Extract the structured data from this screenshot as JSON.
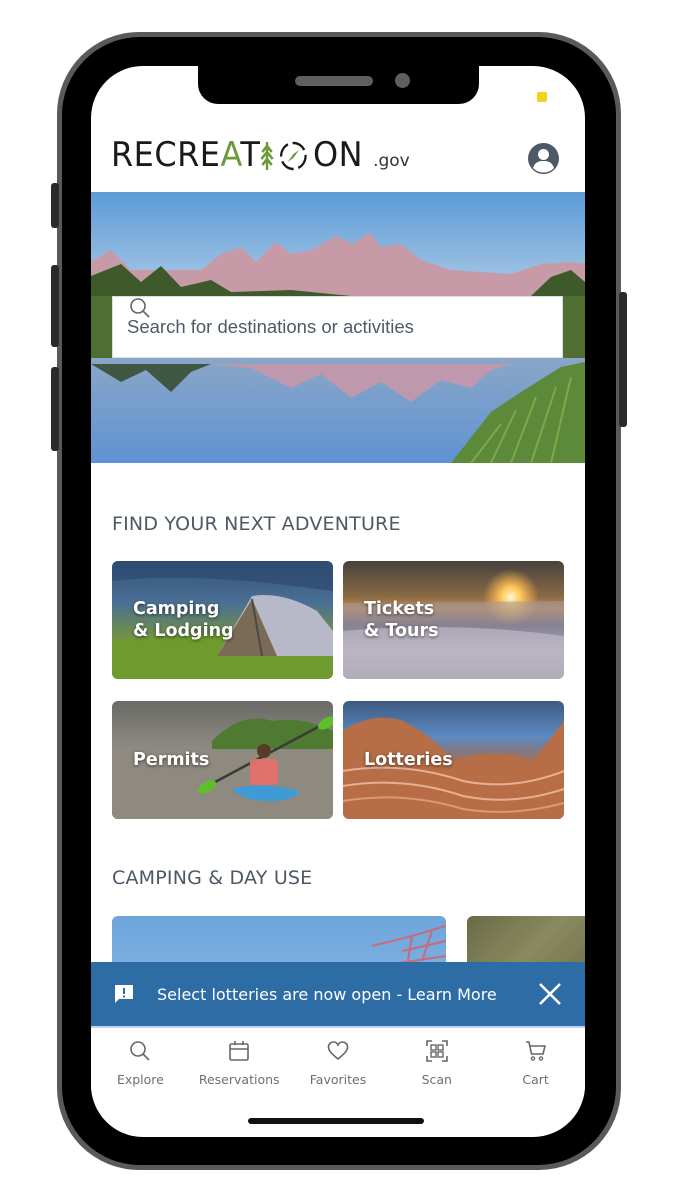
{
  "device": {
    "status_indicator_color": "#f2d31b"
  },
  "header": {
    "logo": {
      "prefix": "RECRE",
      "accent": "A",
      "middle": "T",
      "suffix": "ON",
      "domain": ".gov",
      "full": "RECREATION.gov"
    },
    "account_icon": "account-circle-icon"
  },
  "search": {
    "placeholder": "Search for destinations or activities",
    "value": "",
    "icon": "search-icon"
  },
  "adventure": {
    "title": "FIND YOUR NEXT ADVENTURE",
    "tiles": [
      {
        "label": "Camping\n& Lodging",
        "image": "tent-on-hillside"
      },
      {
        "label": "Tickets\n& Tours",
        "image": "sunset-over-snow"
      },
      {
        "label": "Permits",
        "image": "kayaker-on-river"
      },
      {
        "label": "Lotteries",
        "image": "sandstone-wave"
      }
    ]
  },
  "camping": {
    "title": "CAMPING & DAY USE",
    "cards": [
      {
        "image": "blue-sky-with-redbud-tree"
      },
      {
        "image": "shrubby-hillside"
      }
    ]
  },
  "alert": {
    "icon": "feedback-alert-icon",
    "text": "Select lotteries are now open - Learn More",
    "close_icon": "close-icon",
    "background": "#2e6ca6"
  },
  "nav": {
    "items": [
      {
        "label": "Explore",
        "icon": "search-icon"
      },
      {
        "label": "Reservations",
        "icon": "calendar-icon"
      },
      {
        "label": "Favorites",
        "icon": "heart-icon"
      },
      {
        "label": "Scan",
        "icon": "qr-scan-icon"
      },
      {
        "label": "Cart",
        "icon": "cart-icon"
      }
    ]
  }
}
